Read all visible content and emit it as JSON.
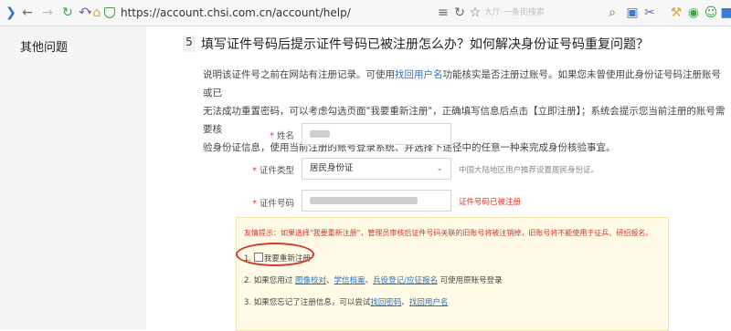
{
  "browser": {
    "url": "https://account.chsi.com.cn/account/help/",
    "search_placeholder": "大厅·一条街搜索",
    "icons": [
      "logo-icon",
      "back-icon",
      "forward-icon",
      "reload-icon",
      "undo-icon",
      "home-icon",
      "shield-icon",
      "reader-icon",
      "refresh-icon",
      "star-icon",
      "search-icon",
      "cut-icon",
      "tool-icon",
      "game-icon",
      "face-icon",
      "puzzle-icon"
    ]
  },
  "sidebar": {
    "items": [
      {
        "label": "其他问题"
      }
    ]
  },
  "question": {
    "number": "5",
    "title": "填写证件号码后提示证件号码已被注册怎么办？如何解决身份证号码重复问题？",
    "desc_1a": "说明该证件号之前在网站有注册记录。可使用",
    "desc_1_link": "找回用户名",
    "desc_1b": "功能核实是否注册过账号。如果您未曾使用此身份证号码注册账号或已",
    "desc_2": "无法成功重置密码，可以考虑勾选页面\"我要重新注册\"，正确填写信息后点击【立即注册】；系统会提示您当前注册的账号需要核",
    "desc_3": "验身份证信息，使用当前注册的账号登录系统、并选择下途径中的任意一种来完成身份核验事宜。"
  },
  "form": {
    "name_label": "姓名",
    "id_type_label": "证件类型",
    "id_type_value": "居民身份证",
    "id_type_hint": "中国大陆地区用户推荐设置居民身份证。",
    "id_number_label": "证件号码",
    "id_number_error": "证件号码已被注册",
    "required_mark": "*"
  },
  "notice": {
    "warning": "友情提示：如果选择\"我要重新注册\"，管理员审核后证件号码关联的旧账号将被注销掉，旧账号将不能使用于征兵、研招报名。",
    "item1_prefix": "1.",
    "item1_label": "我要重新注册",
    "item2_prefix": "2. 如果您用过",
    "item2_link1": "图像校对",
    "item2_sep1": "、",
    "item2_link2": "学信档案",
    "item2_sep2": "、",
    "item2_link3": "兵役登记/应征报名",
    "item2_suffix": " 可使用原账号登录",
    "item3_prefix": "3. 如果您忘记了注册信息，可以尝试",
    "item3_link1": "找回密码",
    "item3_sep": "、",
    "item3_link2": "找回用户名"
  },
  "colors": {
    "accent": "#2b6fc2",
    "error": "#e0332d",
    "notice_bg": "#fffbe6",
    "annotation": "#d23a2e"
  }
}
